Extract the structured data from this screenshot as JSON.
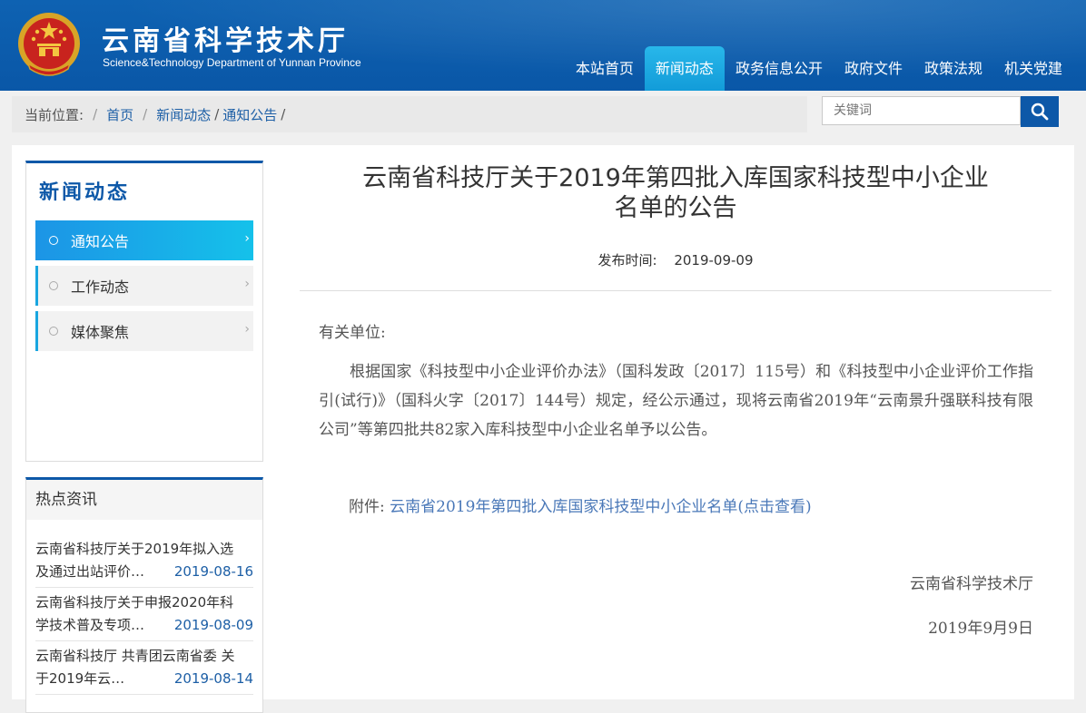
{
  "header": {
    "title": "云南省科学技术厅",
    "subtitle": "Science&Technology Department of Yunnan Province",
    "nav": [
      "本站首页",
      "新闻动态",
      "政务信息公开",
      "政府文件",
      "政策法规",
      "机关党建"
    ],
    "active_nav": "新闻动态"
  },
  "breadcrumb": {
    "prefix": "当前位置:",
    "items": [
      "首页",
      "新闻动态",
      "通知公告"
    ]
  },
  "search": {
    "placeholder": "关键词"
  },
  "sidebar": {
    "title": "新闻动态",
    "items": [
      {
        "label": "通知公告"
      },
      {
        "label": "工作动态"
      },
      {
        "label": "媒体聚焦"
      }
    ]
  },
  "hot_news": {
    "title": "热点资讯",
    "items": [
      {
        "line1": "云南省科技厅关于2019年拟入选",
        "line2": "及通过出站评价…",
        "date": "2019-08-16"
      },
      {
        "line1": "云南省科技厅关于申报2020年科",
        "line2": "学技术普及专项…",
        "date": "2019-08-09"
      },
      {
        "line1": "云南省科技厅 共青团云南省委 关",
        "line2": "于2019年云…",
        "date": "2019-08-14"
      }
    ]
  },
  "article": {
    "title_line1": "云南省科技厅关于2019年第四批入库国家科技型中小企业",
    "title_line2": "名单的公告",
    "publish_label": "发布时间:",
    "publish_date": "2019-09-09",
    "salutation": "有关单位:",
    "paragraph": "根据国家《科技型中小企业评价办法》（国科发政〔2017〕115号）和《科技型中小企业评价工作指引(试行)》（国科火字〔2017〕144号）规定，经公示通过，现将云南省2019年“云南景升强联科技有限公司”等第四批共82家入库科技型中小企业名单予以公告。",
    "attachment_label": "附件:",
    "attachment_link": "云南省2019年第四批入库国家科技型中小企业名单(点击查看)",
    "signature_org": "云南省科学技术厅",
    "signature_date": "2019年9月9日"
  },
  "colors": {
    "header_blue": "#0d58a8",
    "nav_active": "#129bd8",
    "link_blue": "#1d5fa6",
    "sidebar_active": "#15c1ea"
  },
  "icons": {
    "emblem": "national-emblem-icon",
    "search": "search-icon"
  }
}
